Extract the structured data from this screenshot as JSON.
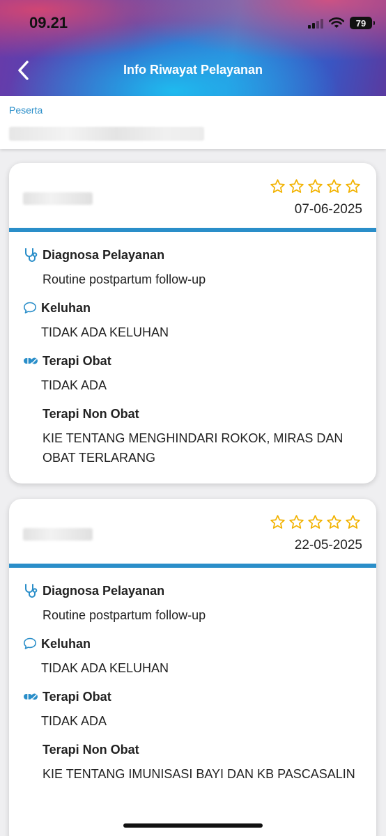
{
  "status_bar": {
    "time": "09.21",
    "battery": "79"
  },
  "header": {
    "title": "Info Riwayat Pelayanan",
    "back_icon": "chevron-left-icon"
  },
  "peserta": {
    "label": "Peserta"
  },
  "colors": {
    "accent": "#2a8ec9",
    "star": "#f2b200"
  },
  "records": [
    {
      "date": "07-06-2025",
      "rating": 0,
      "max_rating": 5,
      "diagnosa_label": "Diagnosa Pelayanan",
      "diagnosa_value": "Routine postpartum follow-up",
      "keluhan_label": "Keluhan",
      "keluhan_value": "TIDAK ADA KELUHAN",
      "terapi_obat_label": "Terapi Obat",
      "terapi_obat_value": "TIDAK ADA",
      "terapi_non_obat_label": "Terapi Non Obat",
      "terapi_non_obat_value": "KIE TENTANG MENGHINDARI ROKOK, MIRAS DAN OBAT TERLARANG"
    },
    {
      "date": "22-05-2025",
      "rating": 0,
      "max_rating": 5,
      "diagnosa_label": "Diagnosa Pelayanan",
      "diagnosa_value": "Routine postpartum follow-up",
      "keluhan_label": "Keluhan",
      "keluhan_value": "TIDAK ADA KELUHAN",
      "terapi_obat_label": "Terapi Obat",
      "terapi_obat_value": "TIDAK ADA",
      "terapi_non_obat_label": "Terapi Non Obat",
      "terapi_non_obat_value": "KIE TENTANG IMUNISASI BAYI DAN KB PASCASALIN"
    }
  ]
}
